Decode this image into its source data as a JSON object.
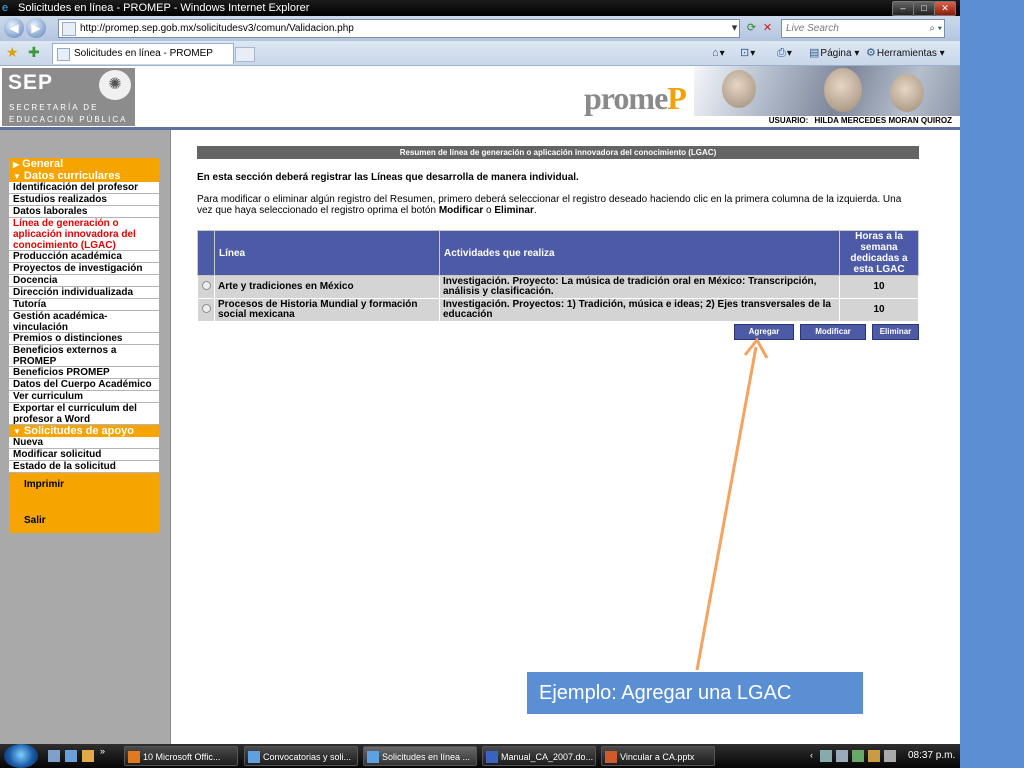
{
  "window": {
    "title": "Solicitudes en línea - PROMEP - Windows Internet Explorer",
    "controls": [
      "–",
      "□",
      "✕"
    ]
  },
  "browser": {
    "url": "http://promep.sep.gob.mx/solicitudesv3/comun/Validacion.php",
    "search_placeholder": "Live Search",
    "tab_title": "Solicitudes en línea - PROMEP",
    "pagina_label": "Página",
    "herramientas_label": "Herramientas"
  },
  "header": {
    "logo_text": "SEP",
    "logo_line1": "SECRETARÍA DE",
    "logo_line2": "EDUCACIÓN PÚBLICA",
    "brand_pre": "prome",
    "brand_post": "P",
    "user_label": "USUARIO:",
    "user_name": "HILDA MERCEDES MORAN QUIROZ"
  },
  "sidebar": {
    "general": "General",
    "datos_curriculares": "Datos curriculares",
    "items": [
      "Identificación del profesor",
      "Estudios realizados",
      "Datos laborales",
      "Línea de generación o aplicación innovadora del conocimiento (LGAC)",
      "Producción académica",
      "Proyectos de investigación",
      "Docencia",
      "Dirección individualizada",
      "Tutoría",
      "Gestión académica-vinculación",
      "Premios o distinciones",
      "Beneficios externos a PROMEP",
      "Beneficios PROMEP",
      "Datos del Cuerpo Académico",
      "Ver curriculum",
      "Exportar el curriculum del profesor a Word"
    ],
    "solicitudes_apoyo": "Solicitudes de apoyo",
    "sol_items": [
      "Nueva",
      "Modificar solicitud",
      "Estado de la solicitud"
    ],
    "imprimir": "Imprimir",
    "salir": "Salir"
  },
  "main": {
    "section_title": "Resumen de línea de generación o aplicación innovadora del conocimiento (LGAC)",
    "intro": "En esta sección deberá registrar las Líneas que desarrolla de manera individual.",
    "help_pre": "Para modificar o eliminar algún registro del Resumen, primero deberá seleccionar el registro deseado haciendo clic en la primera columna de la izquierda. Una vez que haya seleccionado el registro oprima el botón ",
    "help_b1": "Modificar",
    "help_mid": " o ",
    "help_b2": "Eliminar",
    "help_end": ".",
    "table": {
      "headers": [
        "Línea",
        "Actividades que realiza",
        "Horas a la semana dedicadas a esta LGAC"
      ],
      "rows": [
        {
          "linea": "Arte y tradiciones en México",
          "actividades": "Investigación. Proyecto: La música de tradición oral en México: Transcripción, análisis y clasificación.",
          "horas": "10"
        },
        {
          "linea": "Procesos de Historia Mundial y formación social mexicana",
          "actividades": "Investigación. Proyectos: 1) Tradición, música e ideas; 2) Ejes transversales de la educación",
          "horas": "10"
        }
      ]
    },
    "buttons": {
      "agregar": "Agregar",
      "modificar": "Modificar",
      "eliminar": "Eliminar"
    }
  },
  "annotation": {
    "callout": "Ejemplo: Agregar una LGAC",
    "arrow_color": "#f4a460"
  },
  "taskbar": {
    "tasks": [
      "10 Microsoft Offic...",
      "Convocatorias y soli...",
      "Solicitudes en línea ...",
      "Manual_CA_2007.do...",
      "Vincular a CA.pptx"
    ],
    "clock": "08:37 p.m."
  }
}
